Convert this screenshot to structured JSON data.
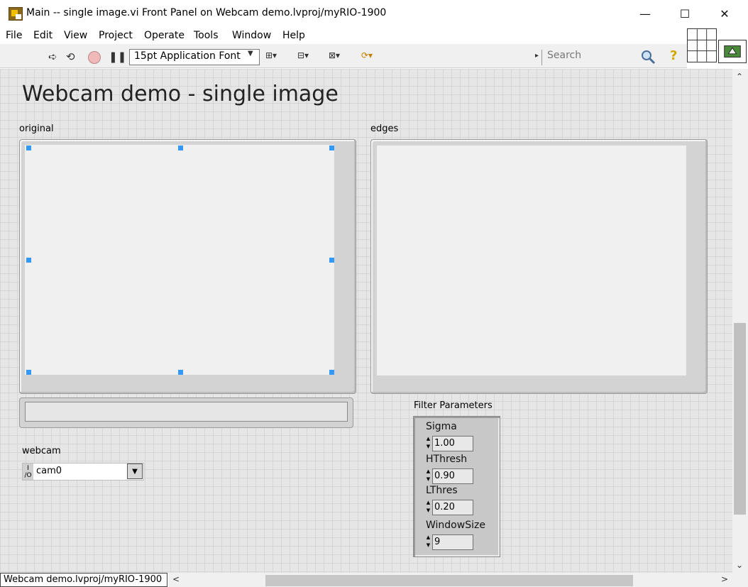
{
  "window": {
    "title": "Main -- single image.vi Front Panel on Webcam demo.lvproj/myRIO-1900",
    "minimize_glyph": "—",
    "maximize_glyph": "☐",
    "close_glyph": "✕"
  },
  "menu": [
    "File",
    "Edit",
    "View",
    "Project",
    "Operate",
    "Tools",
    "Window",
    "Help"
  ],
  "toolbar": {
    "run_icon": "run-arrow-icon",
    "font_select": "15pt Application Font",
    "search_placeholder": "Search",
    "help_glyph": "?"
  },
  "panel": {
    "title": "Webcam demo - single image",
    "original_label": "original",
    "edges_label": "edges",
    "webcam_label": "webcam",
    "webcam_value": "cam0",
    "io_tag": "I/O",
    "filter_label": "Filter Parameters",
    "params": [
      {
        "label": "Sigma",
        "value": "1.00"
      },
      {
        "label": "HThresh",
        "value": "0.90"
      },
      {
        "label": "LThres",
        "value": "0.20"
      },
      {
        "label": "WindowSize",
        "value": "9"
      }
    ]
  },
  "status": {
    "project_tab": "Webcam demo.lvproj/myRIO-1900"
  },
  "colors": {
    "canvas": "#e6e6e6",
    "grid": "#d6d6d6",
    "selection_handle": "#3399ff"
  }
}
